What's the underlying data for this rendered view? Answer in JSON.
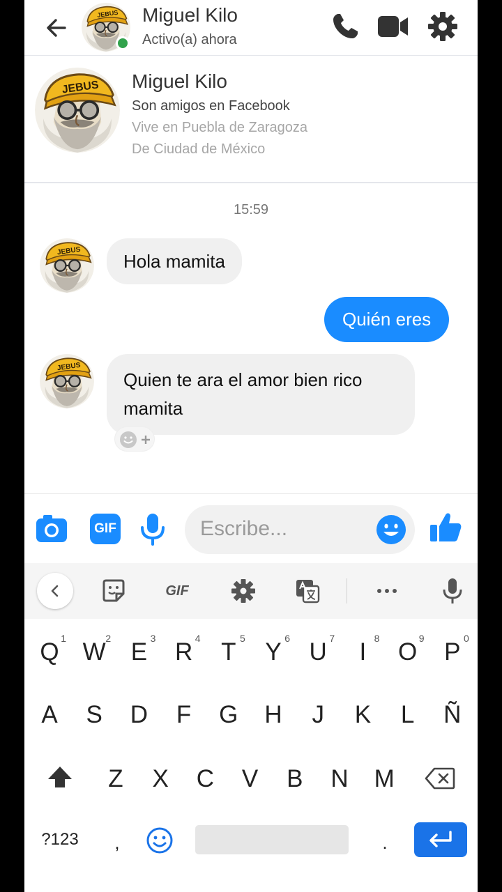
{
  "header": {
    "name": "Miguel Kilo",
    "status": "Activo(a) ahora",
    "icons": [
      "back-arrow-icon",
      "phone-icon",
      "video-camera-icon",
      "gear-icon"
    ]
  },
  "profile": {
    "name": "Miguel Kilo",
    "friends": "Son amigos en Facebook",
    "lives": "Vive en Puebla de Zaragoza",
    "from": "De Ciudad de México"
  },
  "avatar": {
    "cap_text": "JEBUS"
  },
  "chat": {
    "timestamp": "15:59",
    "messages": [
      {
        "from": "them",
        "text": "Hola mamita"
      },
      {
        "from": "me",
        "text": "Quién eres"
      },
      {
        "from": "them",
        "text": "Quien te ara el amor bien rico mamita"
      }
    ]
  },
  "composer": {
    "placeholder": "Escribe...",
    "gif_label": "GIF",
    "icons": [
      "camera-icon",
      "gif-icon",
      "microphone-icon",
      "emoji-icon",
      "thumbs-up-icon"
    ]
  },
  "keyboard": {
    "toolbar_gif": "GIF",
    "row1": [
      {
        "k": "Q",
        "s": "1"
      },
      {
        "k": "W",
        "s": "2"
      },
      {
        "k": "E",
        "s": "3"
      },
      {
        "k": "R",
        "s": "4"
      },
      {
        "k": "T",
        "s": "5"
      },
      {
        "k": "Y",
        "s": "6"
      },
      {
        "k": "U",
        "s": "7"
      },
      {
        "k": "I",
        "s": "8"
      },
      {
        "k": "O",
        "s": "9"
      },
      {
        "k": "P",
        "s": "0"
      }
    ],
    "row2": [
      "A",
      "S",
      "D",
      "F",
      "G",
      "H",
      "J",
      "K",
      "L",
      "Ñ"
    ],
    "row3": [
      "Z",
      "X",
      "C",
      "V",
      "B",
      "N",
      "M"
    ],
    "sym_label": "?123",
    "comma": ",",
    "period": "."
  },
  "colors": {
    "accent": "#1a8cff",
    "online": "#31a24c",
    "enter": "#1a73e8"
  }
}
